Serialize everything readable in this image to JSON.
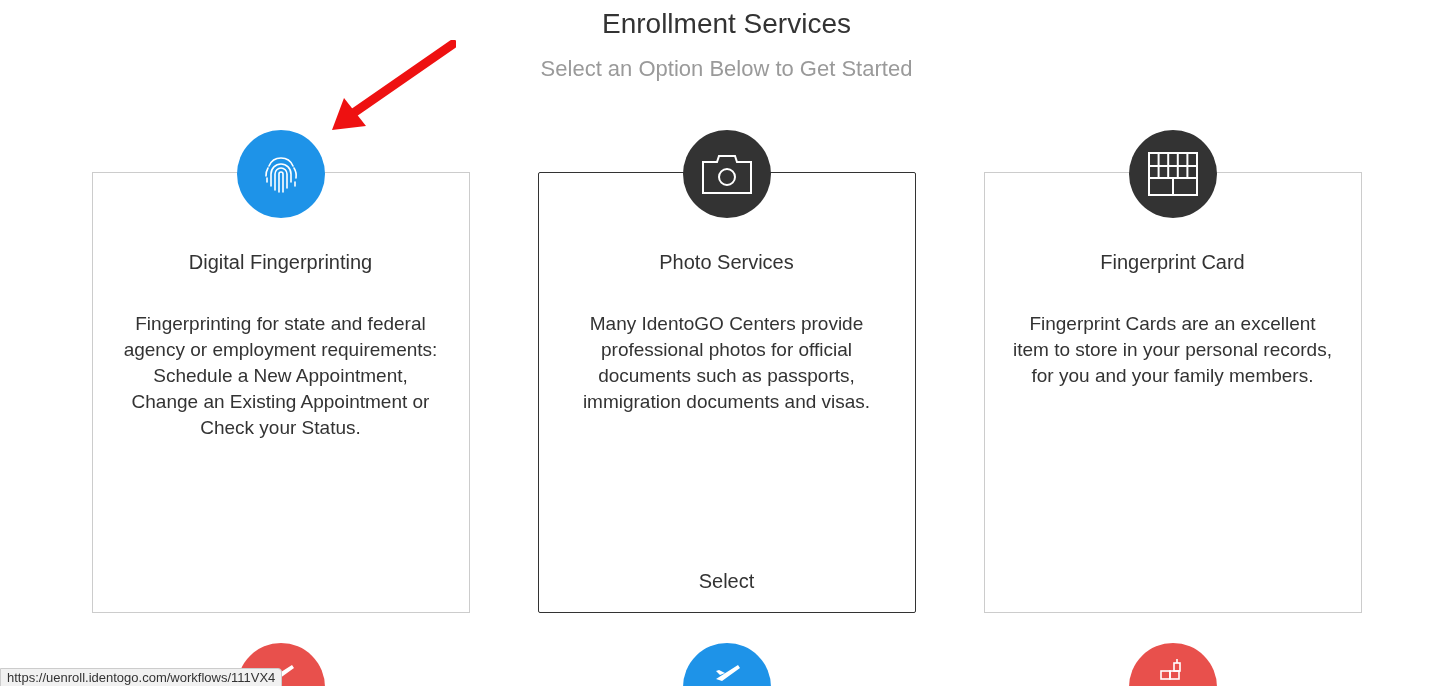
{
  "header": {
    "title": "Enrollment Services",
    "subtitle": "Select an Option Below to Get Started"
  },
  "cards": [
    {
      "kind": "fingerprint",
      "color": "#1e93e8",
      "title": "Digital Fingerprinting",
      "description": "Fingerprinting for state and federal agency or employment requirements: Schedule a New Appointment, Change an Existing Appointment or Check your Status.",
      "hovered": false
    },
    {
      "kind": "camera",
      "color": "#333333",
      "title": "Photo Services",
      "description": "Many IdentoGO Centers provide professional photos for official documents such as passports, immigration documents and visas.",
      "hovered": true,
      "action": "Select"
    },
    {
      "kind": "card",
      "color": "#333333",
      "title": "Fingerprint Card",
      "description": "Fingerprint Cards are an excellent item to store in your personal records, for you and your family members.",
      "hovered": false
    }
  ],
  "next_row": [
    {
      "kind": "plane",
      "color": "#e8504c"
    },
    {
      "kind": "plane",
      "color": "#1e93e8"
    },
    {
      "kind": "boxes",
      "color": "#e8504c"
    }
  ],
  "status_url": "https://uenroll.identogo.com/workflows/111VX4"
}
